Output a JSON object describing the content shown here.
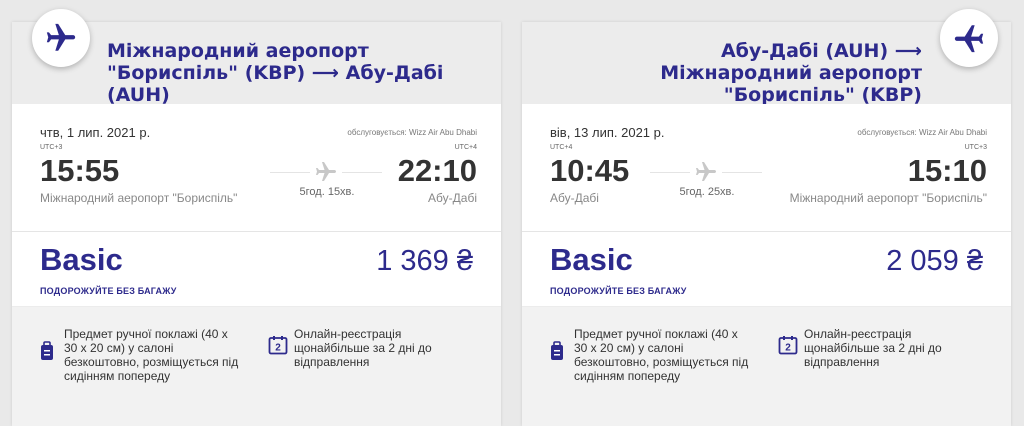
{
  "cards": [
    {
      "route_title": "Міжнародний аеропорт \"Бориспіль\" (KBP) ⟶ Абу-Дабі (AUH)",
      "date": "чтв, 1 лип. 2021 р.",
      "operated_by": "обслуговується: Wizz Air Abu Dhabi",
      "dep_utc": "UTC+3",
      "arr_utc": "UTC+4",
      "dep_time": "15:55",
      "arr_time": "22:10",
      "duration": "5год. 15хв.",
      "dep_airport": "Міжнародний аеропорт \"Бориспіль\"",
      "arr_airport": "Абу-Дабі",
      "fare_name": "Basic",
      "fare_subtitle": "ПОДОРОЖУЙТЕ БЕЗ БАГАЖУ",
      "price": "1 369 ₴",
      "benefit_bag": "Предмет ручної поклажі (40 x 30 x 20 см) у салоні безкоштовно, розміщується під сидінням попереду",
      "benefit_checkin": "Онлайн-реєстрація щонайбільше за 2 дні до відправлення",
      "calendar_number": "2"
    },
    {
      "route_title": "Абу-Дабі (AUH) ⟶ Міжнародний аеропорт \"Бориспіль\" (KBP)",
      "date": "вів, 13 лип. 2021 р.",
      "operated_by": "обслуговується: Wizz Air Abu Dhabi",
      "dep_utc": "UTC+4",
      "arr_utc": "UTC+3",
      "dep_time": "10:45",
      "arr_time": "15:10",
      "duration": "5год. 25хв.",
      "dep_airport": "Абу-Дабі",
      "arr_airport": "Міжнародний аеропорт \"Бориспіль\"",
      "fare_name": "Basic",
      "fare_subtitle": "ПОДОРОЖУЙТЕ БЕЗ БАГАЖУ",
      "price": "2 059 ₴",
      "benefit_bag": "Предмет ручної поклажі (40 x 30 x 20 см) у салоні безкоштовно, розміщується під сидінням попереду",
      "benefit_checkin": "Онлайн-реєстрація щонайбільше за 2 дні до відправлення",
      "calendar_number": "2"
    }
  ],
  "colors": {
    "brand": "#2d2a8c",
    "icon_blue": "#2d2a8c"
  }
}
